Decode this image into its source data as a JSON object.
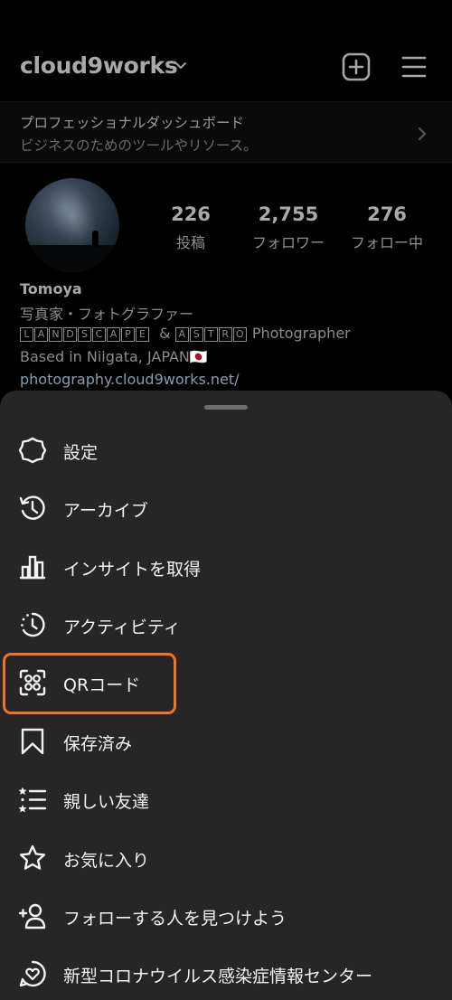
{
  "header": {
    "username": "cloud9works",
    "icons": [
      "chevron-down-icon",
      "add-post-icon",
      "hamburger-menu-icon"
    ]
  },
  "dashboard": {
    "title": "プロフェッショナルダッシュボード",
    "subtitle": "ビジネスのためのツールやリソース。"
  },
  "profile": {
    "stats": [
      {
        "value": "226",
        "label": "投稿"
      },
      {
        "value": "2,755",
        "label": "フォロワー"
      },
      {
        "value": "276",
        "label": "フォロー中"
      }
    ],
    "name": "Tomoya",
    "bio_line1": "写真家・フォトグラファー",
    "bio_line2": {
      "word1": [
        "L",
        "A",
        "N",
        "D",
        "S",
        "C",
        "A",
        "P",
        "E"
      ],
      "amp": " & ",
      "word2": [
        "A",
        "S",
        "T",
        "R",
        "O"
      ],
      "suffix": " Photographer"
    },
    "bio_line3": "Based in Niigata, JAPAN🇯🇵",
    "link": "photography.cloud9works.net/"
  },
  "menu": {
    "items": [
      {
        "label": "設定",
        "icon": "settings-icon"
      },
      {
        "label": "アーカイブ",
        "icon": "archive-icon"
      },
      {
        "label": "インサイトを取得",
        "icon": "insights-icon"
      },
      {
        "label": "アクティビティ",
        "icon": "activity-icon"
      },
      {
        "label": "QRコード",
        "icon": "qr-code-icon",
        "highlighted": true
      },
      {
        "label": "保存済み",
        "icon": "bookmark-icon"
      },
      {
        "label": "親しい友達",
        "icon": "close-friends-icon"
      },
      {
        "label": "お気に入り",
        "icon": "star-icon"
      },
      {
        "label": "フォローする人を見つけよう",
        "icon": "add-person-icon"
      },
      {
        "label": "新型コロナウイルス感染症情報センター",
        "icon": "covid-info-icon"
      }
    ]
  },
  "colors": {
    "background": "#000000",
    "sheet": "#262626",
    "highlight": "#f2741f"
  }
}
